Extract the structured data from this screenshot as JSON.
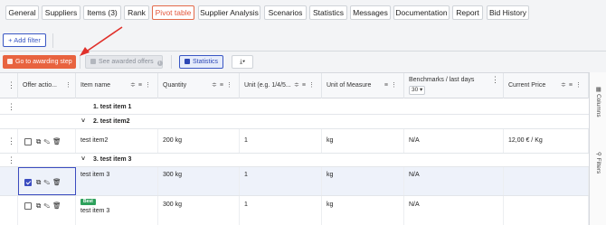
{
  "tabs": [
    {
      "label": "General",
      "active": false
    },
    {
      "label": "Suppliers",
      "active": false
    },
    {
      "label": "Items (3)",
      "active": false
    },
    {
      "label": "Rank",
      "active": false
    },
    {
      "label": "Pivot table",
      "active": true
    },
    {
      "label": "Supplier Analysis",
      "active": false
    },
    {
      "label": "Scenarios",
      "active": false
    },
    {
      "label": "Statistics",
      "active": false
    },
    {
      "label": "Messages",
      "active": false
    },
    {
      "label": "Documentation",
      "active": false
    },
    {
      "label": "Report",
      "active": false
    },
    {
      "label": "Bid History",
      "active": false
    }
  ],
  "toolbar": {
    "add_filter": "+ Add filter",
    "award_step": "Go to awarding step",
    "see_awarded": "See awarded offers",
    "statistics": "Statistics",
    "download": "⤓▾"
  },
  "columns": {
    "offer_actions": "Offer actio...",
    "item_name": "Item name",
    "quantity": "Quantity",
    "unit": "Unit (e.g. 1/4/5...",
    "uom": "Unit of Measure",
    "benchmarks": "Benchmarks / last days",
    "benchmarks_days": "30",
    "current_price": "Current Price"
  },
  "groups": {
    "g1": "1. test item 1",
    "g2": "2. test item2",
    "g3": "3. test item 3"
  },
  "rows": [
    {
      "item": "test item2",
      "quantity": "200 kg",
      "unit": "1",
      "uom": "kg",
      "bench": "N/A",
      "price": "12,00 € / Kg",
      "checked": false
    },
    {
      "item": "test item 3",
      "quantity": "300 kg",
      "unit": "1",
      "uom": "kg",
      "bench": "N/A",
      "price": "",
      "checked": true
    },
    {
      "item": "test item 3",
      "quantity": "300 kg",
      "unit": "1",
      "uom": "kg",
      "bench": "N/A",
      "price": "",
      "checked": false,
      "badge": "Best"
    }
  ],
  "side": {
    "columns": "Columns",
    "filters": "Filters"
  },
  "colors": {
    "accent": "#e8633f",
    "primary": "#3a57c4",
    "best": "#2ea15c"
  }
}
